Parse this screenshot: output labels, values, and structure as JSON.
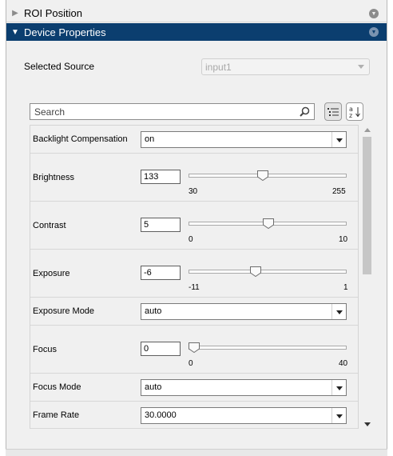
{
  "panels": {
    "roi": {
      "title": "ROI Position",
      "expanded": false
    },
    "device": {
      "title": "Device Properties",
      "expanded": true
    }
  },
  "source": {
    "label": "Selected Source",
    "value": "input1",
    "enabled": false
  },
  "search": {
    "placeholder": "Search"
  },
  "toolbar": {
    "categorized_icon": "categorized-list-icon",
    "alphabetical_icon": "sort-alpha-icon"
  },
  "properties": {
    "backlight": {
      "label": "Backlight Compensation",
      "value": "on"
    },
    "brightness": {
      "label": "Brightness",
      "value": "133",
      "min": "30",
      "max": "255",
      "level": 0.46
    },
    "contrast": {
      "label": "Contrast",
      "value": "5",
      "min": "0",
      "max": "10",
      "level": 0.5
    },
    "exposure": {
      "label": "Exposure",
      "value": "-6",
      "min": "-11",
      "max": "1",
      "level": 0.42
    },
    "exposure_mode": {
      "label": "Exposure Mode",
      "value": "auto"
    },
    "focus": {
      "label": "Focus",
      "value": "0",
      "min": "0",
      "max": "40",
      "level": 0.0
    },
    "focus_mode": {
      "label": "Focus Mode",
      "value": "auto"
    },
    "frame_rate": {
      "label": "Frame Rate",
      "value": "30.0000"
    }
  },
  "colors": {
    "header_bg": "#0b3e6f",
    "panel_bg": "#f0f0f0"
  }
}
